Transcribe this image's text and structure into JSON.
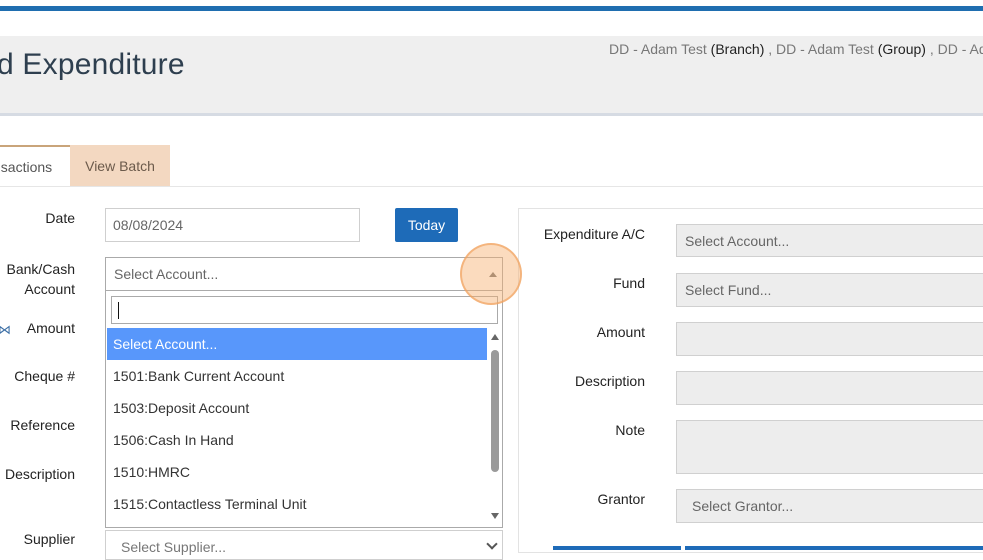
{
  "header": {
    "title": "d Expenditure",
    "breadcrumb": [
      {
        "text": "DD - Adam Test ",
        "bold": "(Branch)",
        "sep": " , "
      },
      {
        "text": "DD - Adam Test ",
        "bold": "(Group)",
        "sep": " , "
      },
      {
        "text": "DD - Ada",
        "bold": "",
        "sep": ""
      }
    ]
  },
  "tabs": {
    "transactions": "nsactions",
    "view_batch": "View Batch"
  },
  "left_form": {
    "date_label": "Date",
    "date_value": "08/08/2024",
    "today_button": "Today",
    "bank_label_line1": "Bank/Cash",
    "bank_label_line2": "Account",
    "bank_placeholder": "Select Account...",
    "amount_label": "Amount",
    "cheque_label": "Cheque #",
    "reference_label": "Reference",
    "description_label": "Description",
    "supplier_label": "Supplier",
    "supplier_placeholder": "Select Supplier..."
  },
  "dropdown": {
    "search_value": "",
    "options": [
      "Select Account...",
      "1501:Bank Current Account",
      "1503:Deposit Account",
      "1506:Cash In Hand",
      "1510:HMRC",
      "1515:Contactless Terminal Unit"
    ],
    "selected_index": 0
  },
  "right_form": {
    "expenditure_label": "Expenditure A/C",
    "expenditure_placeholder": "Select Account...",
    "fund_label": "Fund",
    "fund_placeholder": "Select Fund...",
    "amount_label": "Amount",
    "description_label": "Description",
    "note_label": "Note",
    "grantor_label": "Grantor",
    "grantor_placeholder": "Select Grantor..."
  },
  "colors": {
    "accent": "#1e6bb8",
    "selected_option": "#5897fb",
    "tab_active_bg": "#f3d8c1",
    "highlight": "#f7b06e"
  }
}
